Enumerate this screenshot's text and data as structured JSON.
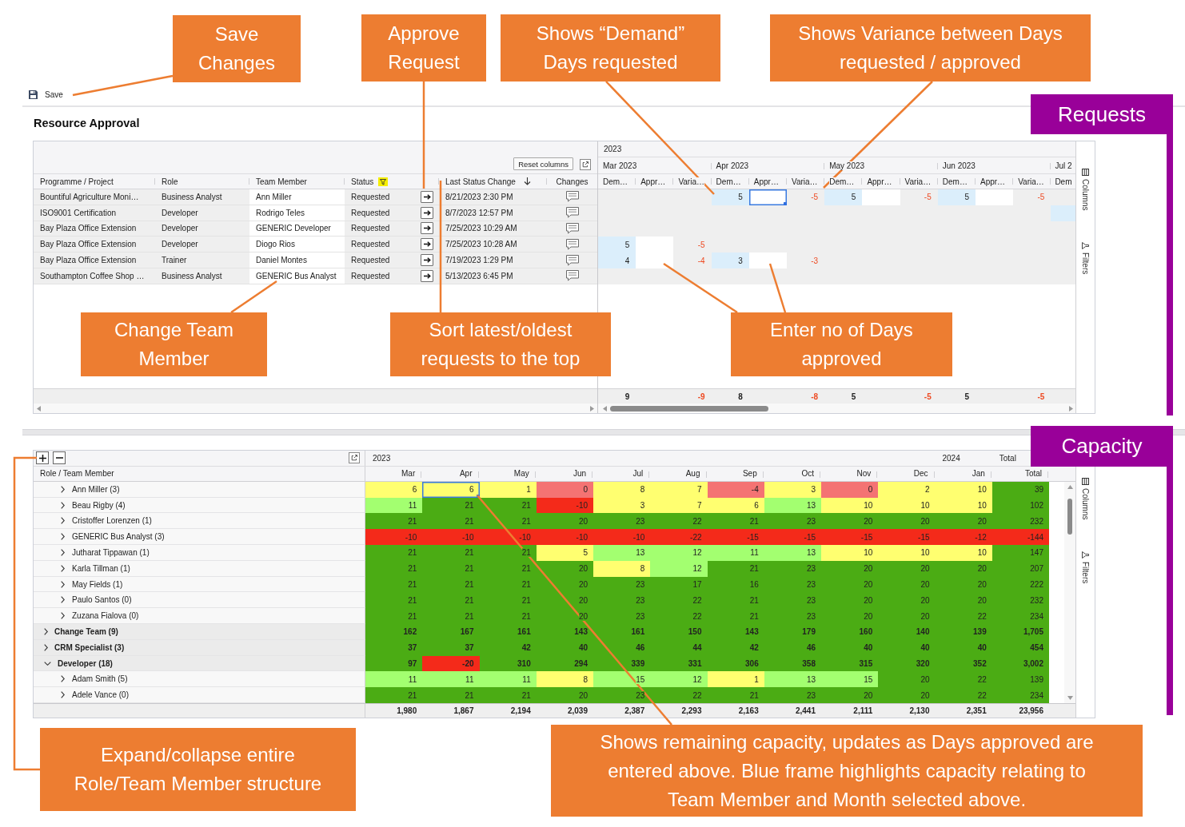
{
  "toolbar": {
    "save_label": "Save"
  },
  "page_title": "Resource Approval",
  "requests": {
    "reset_button": "Reset columns",
    "columns": [
      {
        "kind": "text",
        "label": "Programme / Project",
        "filtered": false,
        "sorted": false
      },
      {
        "kind": "text",
        "label": "Role",
        "filtered": false,
        "sorted": false
      },
      {
        "kind": "text",
        "label": "Team Member",
        "filtered": false,
        "sorted": false
      },
      {
        "kind": "text",
        "label": "Status",
        "filtered": true,
        "sorted": false
      },
      {
        "kind": "action"
      },
      {
        "kind": "text",
        "label": "Last Status Change",
        "filtered": false,
        "sorted": true
      },
      {
        "kind": "text",
        "label": "Changes",
        "filtered": false,
        "sorted": false
      }
    ],
    "year": "2023",
    "months": [
      {
        "label": "Mar 2023",
        "columns": [
          "Dem…",
          "Appr…",
          "Varia…"
        ]
      },
      {
        "label": "Apr 2023",
        "columns": [
          "Dem…",
          "Appr…",
          "Varia…"
        ]
      },
      {
        "label": "May 2023",
        "columns": [
          "Dem…",
          "Appr…",
          "Varia…"
        ]
      },
      {
        "label": "Jun 2023",
        "columns": [
          "Dem…",
          "Appr…",
          "Varia…"
        ]
      },
      {
        "label": "Jul 2",
        "columns": [
          "Dem"
        ]
      }
    ],
    "rows": [
      {
        "programme": "Bountiful Agriculture Moni…",
        "role": "Business Analyst",
        "team_member": "Ann Miller",
        "status": "Requested",
        "last_status_change": "8/21/2023 2:30 PM",
        "cells": [
          {
            "kind": "empty"
          },
          {
            "kind": "request",
            "demand": "5",
            "variance": "-5",
            "selected": true
          },
          {
            "kind": "request",
            "demand": "5",
            "variance": "-5",
            "selected": false
          },
          {
            "kind": "request",
            "demand": "5",
            "variance": "-5",
            "selected": false
          }
        ]
      },
      {
        "programme": "ISO9001 Certification",
        "role": "Developer",
        "team_member": "Rodrigo Teles",
        "status": "Requested",
        "last_status_change": "8/7/2023 12:57 PM",
        "cells": [
          {
            "kind": "empty"
          },
          {
            "kind": "empty"
          },
          {
            "kind": "empty"
          },
          {
            "kind": "empty"
          },
          {
            "kind": "request"
          }
        ]
      },
      {
        "programme": "Bay Plaza Office Extension",
        "role": "Developer",
        "team_member": "GENERIC Developer",
        "status": "Requested",
        "last_status_change": "7/25/2023 10:29 AM"
      },
      {
        "programme": "Bay Plaza Office Extension",
        "role": "Developer",
        "team_member": "Diogo Rios",
        "status": "Requested",
        "last_status_change": "7/25/2023 10:28 AM",
        "cells": [
          {
            "kind": "request",
            "demand": "5",
            "variance": "-5",
            "selected": false
          }
        ]
      },
      {
        "programme": "Bay Plaza Office Extension",
        "role": "Trainer",
        "team_member": "Daniel Montes",
        "status": "Requested",
        "last_status_change": "7/19/2023 1:29 PM",
        "cells": [
          {
            "kind": "request",
            "demand": "4",
            "variance": "-4",
            "selected": false
          },
          {
            "kind": "request",
            "demand": "3",
            "variance": "-3",
            "selected": false
          }
        ]
      },
      {
        "programme": "Southampton Coffee Shop …",
        "role": "Business Analyst",
        "team_member": "GENERIC Bus Analyst",
        "status": "Requested",
        "last_status_change": "5/13/2023 6:45 PM"
      }
    ],
    "totals": [
      {
        "demand": "9",
        "variance": "-9"
      },
      {
        "demand": "8",
        "variance": "-8"
      },
      {
        "demand": "5",
        "variance": "-5"
      },
      {
        "demand": "5",
        "variance": "-5"
      }
    ],
    "side_panel": [
      {
        "kind": "columns",
        "label": "Columns"
      },
      {
        "kind": "filters",
        "label": "Filters"
      }
    ]
  },
  "capacity": {
    "year_groups": [
      {
        "label": "2023",
        "months": [
          "Mar",
          "Apr",
          "May",
          "Jun",
          "Jul",
          "Aug",
          "Sep",
          "Oct",
          "Nov",
          "Dec"
        ]
      },
      {
        "label": "2024",
        "months": [
          "Jan"
        ]
      },
      {
        "label": "Total",
        "months": [
          "Total"
        ]
      }
    ],
    "row_header": "Role / Team Member",
    "rows": [
      {
        "kind": "role",
        "children": [
          {
            "kind": "member",
            "label": "Ann Miller (3)",
            "expanded": false,
            "values": [
              {
                "value": "6",
                "color": "#ffff70",
                "selected": false
              },
              {
                "value": "6",
                "color": "#ffff70",
                "selected": true
              },
              {
                "value": "1",
                "color": "#ffff70",
                "selected": false
              },
              {
                "value": "0",
                "color": "#f47373",
                "selected": false
              },
              {
                "value": "8",
                "color": "#ffff70",
                "selected": false
              },
              {
                "value": "7",
                "color": "#ffff70",
                "selected": false
              },
              {
                "value": "-4",
                "color": "#f47373",
                "selected": false
              },
              {
                "value": "3",
                "color": "#ffff70",
                "selected": false
              },
              {
                "value": "0",
                "color": "#f47373",
                "selected": false
              },
              {
                "value": "2",
                "color": "#ffff70",
                "selected": false
              },
              {
                "value": "10",
                "color": "#ffff70",
                "selected": false
              },
              {
                "value": "39",
                "color": "#4bac14",
                "selected": false
              }
            ]
          },
          {
            "kind": "member",
            "label": "Beau Rigby (4)",
            "expanded": false,
            "values": [
              {
                "value": "11",
                "color": "#a3ff70",
                "selected": false
              },
              {
                "value": "21",
                "color": "#4bac14",
                "selected": false
              },
              {
                "value": "21",
                "color": "#4bac14",
                "selected": false
              },
              {
                "value": "-10",
                "color": "#f42a1a",
                "selected": false
              },
              {
                "value": "3",
                "color": "#ffff70",
                "selected": false
              },
              {
                "value": "7",
                "color": "#ffff70",
                "selected": false
              },
              {
                "value": "6",
                "color": "#ffff70",
                "selected": false
              },
              {
                "value": "13",
                "color": "#a3ff70",
                "selected": false
              },
              {
                "value": "10",
                "color": "#ffff70",
                "selected": false
              },
              {
                "value": "10",
                "color": "#ffff70",
                "selected": false
              },
              {
                "value": "10",
                "color": "#ffff70",
                "selected": false
              },
              {
                "value": "102",
                "color": "#4bac14",
                "selected": false
              }
            ]
          },
          {
            "kind": "member",
            "label": "Cristoffer Lorenzen (1)",
            "expanded": false,
            "values": [
              {
                "value": "21",
                "color": "#4bac14",
                "selected": false
              },
              {
                "value": "21",
                "color": "#4bac14",
                "selected": false
              },
              {
                "value": "21",
                "color": "#4bac14",
                "selected": false
              },
              {
                "value": "20",
                "color": "#4bac14",
                "selected": false
              },
              {
                "value": "23",
                "color": "#4bac14",
                "selected": false
              },
              {
                "value": "22",
                "color": "#4bac14",
                "selected": false
              },
              {
                "value": "21",
                "color": "#4bac14",
                "selected": false
              },
              {
                "value": "23",
                "color": "#4bac14",
                "selected": false
              },
              {
                "value": "20",
                "color": "#4bac14",
                "selected": false
              },
              {
                "value": "20",
                "color": "#4bac14",
                "selected": false
              },
              {
                "value": "20",
                "color": "#4bac14",
                "selected": false
              },
              {
                "value": "232",
                "color": "#4bac14",
                "selected": false
              }
            ]
          },
          {
            "kind": "member",
            "label": "GENERIC Bus Analyst (3)",
            "expanded": false,
            "values": [
              {
                "value": "-10",
                "color": "#f42a1a",
                "selected": false
              },
              {
                "value": "-10",
                "color": "#f42a1a",
                "selected": false
              },
              {
                "value": "-10",
                "color": "#f42a1a",
                "selected": false
              },
              {
                "value": "-10",
                "color": "#f42a1a",
                "selected": false
              },
              {
                "value": "-10",
                "color": "#f42a1a",
                "selected": false
              },
              {
                "value": "-22",
                "color": "#f42a1a",
                "selected": false
              },
              {
                "value": "-15",
                "color": "#f42a1a",
                "selected": false
              },
              {
                "value": "-15",
                "color": "#f42a1a",
                "selected": false
              },
              {
                "value": "-15",
                "color": "#f42a1a",
                "selected": false
              },
              {
                "value": "-15",
                "color": "#f42a1a",
                "selected": false
              },
              {
                "value": "-12",
                "color": "#f42a1a",
                "selected": false
              },
              {
                "value": "-144",
                "color": "#f42a1a",
                "selected": false
              }
            ]
          },
          {
            "kind": "member",
            "label": "Jutharat Tippawan (1)",
            "expanded": false,
            "values": [
              {
                "value": "21",
                "color": "#4bac14",
                "selected": false
              },
              {
                "value": "21",
                "color": "#4bac14",
                "selected": false
              },
              {
                "value": "21",
                "color": "#4bac14",
                "selected": false
              },
              {
                "value": "5",
                "color": "#ffff70",
                "selected": false
              },
              {
                "value": "13",
                "color": "#a3ff70",
                "selected": false
              },
              {
                "value": "12",
                "color": "#a3ff70",
                "selected": false
              },
              {
                "value": "11",
                "color": "#a3ff70",
                "selected": false
              },
              {
                "value": "13",
                "color": "#a3ff70",
                "selected": false
              },
              {
                "value": "10",
                "color": "#ffff70",
                "selected": false
              },
              {
                "value": "10",
                "color": "#ffff70",
                "selected": false
              },
              {
                "value": "10",
                "color": "#ffff70",
                "selected": false
              },
              {
                "value": "147",
                "color": "#4bac14",
                "selected": false
              }
            ]
          },
          {
            "kind": "member",
            "label": "Karla Tillman (1)",
            "expanded": false,
            "values": [
              {
                "value": "21",
                "color": "#4bac14",
                "selected": false
              },
              {
                "value": "21",
                "color": "#4bac14",
                "selected": false
              },
              {
                "value": "21",
                "color": "#4bac14",
                "selected": false
              },
              {
                "value": "20",
                "color": "#4bac14",
                "selected": false
              },
              {
                "value": "8",
                "color": "#ffff70",
                "selected": false
              },
              {
                "value": "12",
                "color": "#a3ff70",
                "selected": false
              },
              {
                "value": "21",
                "color": "#4bac14",
                "selected": false
              },
              {
                "value": "23",
                "color": "#4bac14",
                "selected": false
              },
              {
                "value": "20",
                "color": "#4bac14",
                "selected": false
              },
              {
                "value": "20",
                "color": "#4bac14",
                "selected": false
              },
              {
                "value": "20",
                "color": "#4bac14",
                "selected": false
              },
              {
                "value": "207",
                "color": "#4bac14",
                "selected": false
              }
            ]
          },
          {
            "kind": "member",
            "label": "May Fields (1)",
            "expanded": false,
            "values": [
              {
                "value": "21",
                "color": "#4bac14",
                "selected": false
              },
              {
                "value": "21",
                "color": "#4bac14",
                "selected": false
              },
              {
                "value": "21",
                "color": "#4bac14",
                "selected": false
              },
              {
                "value": "20",
                "color": "#4bac14",
                "selected": false
              },
              {
                "value": "23",
                "color": "#4bac14",
                "selected": false
              },
              {
                "value": "17",
                "color": "#4bac14",
                "selected": false
              },
              {
                "value": "16",
                "color": "#4bac14",
                "selected": false
              },
              {
                "value": "23",
                "color": "#4bac14",
                "selected": false
              },
              {
                "value": "20",
                "color": "#4bac14",
                "selected": false
              },
              {
                "value": "20",
                "color": "#4bac14",
                "selected": false
              },
              {
                "value": "20",
                "color": "#4bac14",
                "selected": false
              },
              {
                "value": "222",
                "color": "#4bac14",
                "selected": false
              }
            ]
          },
          {
            "kind": "member",
            "label": "Paulo Santos (0)",
            "expanded": false,
            "values": [
              {
                "value": "21",
                "color": "#4bac14",
                "selected": false
              },
              {
                "value": "21",
                "color": "#4bac14",
                "selected": false
              },
              {
                "value": "21",
                "color": "#4bac14",
                "selected": false
              },
              {
                "value": "20",
                "color": "#4bac14",
                "selected": false
              },
              {
                "value": "23",
                "color": "#4bac14",
                "selected": false
              },
              {
                "value": "22",
                "color": "#4bac14",
                "selected": false
              },
              {
                "value": "21",
                "color": "#4bac14",
                "selected": false
              },
              {
                "value": "23",
                "color": "#4bac14",
                "selected": false
              },
              {
                "value": "20",
                "color": "#4bac14",
                "selected": false
              },
              {
                "value": "20",
                "color": "#4bac14",
                "selected": false
              },
              {
                "value": "20",
                "color": "#4bac14",
                "selected": false
              },
              {
                "value": "232",
                "color": "#4bac14",
                "selected": false
              }
            ]
          },
          {
            "kind": "member",
            "label": "Zuzana Fialova (0)",
            "expanded": false,
            "values": [
              {
                "value": "21",
                "color": "#4bac14",
                "selected": false
              },
              {
                "value": "21",
                "color": "#4bac14",
                "selected": false
              },
              {
                "value": "21",
                "color": "#4bac14",
                "selected": false
              },
              {
                "value": "20",
                "color": "#4bac14",
                "selected": false
              },
              {
                "value": "23",
                "color": "#4bac14",
                "selected": false
              },
              {
                "value": "22",
                "color": "#4bac14",
                "selected": false
              },
              {
                "value": "21",
                "color": "#4bac14",
                "selected": false
              },
              {
                "value": "23",
                "color": "#4bac14",
                "selected": false
              },
              {
                "value": "20",
                "color": "#4bac14",
                "selected": false
              },
              {
                "value": "20",
                "color": "#4bac14",
                "selected": false
              },
              {
                "value": "22",
                "color": "#4bac14",
                "selected": false
              },
              {
                "value": "234",
                "color": "#4bac14",
                "selected": false
              }
            ]
          }
        ]
      },
      {
        "kind": "role",
        "label": "Change Team (9)",
        "expanded": false,
        "values": [
          {
            "value": "162",
            "color": "#4bac14",
            "selected": false
          },
          {
            "value": "167",
            "color": "#4bac14",
            "selected": false
          },
          {
            "value": "161",
            "color": "#4bac14",
            "selected": false
          },
          {
            "value": "143",
            "color": "#4bac14",
            "selected": false
          },
          {
            "value": "161",
            "color": "#4bac14",
            "selected": false
          },
          {
            "value": "150",
            "color": "#4bac14",
            "selected": false
          },
          {
            "value": "143",
            "color": "#4bac14",
            "selected": false
          },
          {
            "value": "179",
            "color": "#4bac14",
            "selected": false
          },
          {
            "value": "160",
            "color": "#4bac14",
            "selected": false
          },
          {
            "value": "140",
            "color": "#4bac14",
            "selected": false
          },
          {
            "value": "139",
            "color": "#4bac14",
            "selected": false
          },
          {
            "value": "1,705",
            "color": "#4bac14",
            "selected": false
          }
        ]
      },
      {
        "kind": "role",
        "label": "CRM Specialist (3)",
        "expanded": false,
        "values": [
          {
            "value": "37",
            "color": "#4bac14",
            "selected": false
          },
          {
            "value": "37",
            "color": "#4bac14",
            "selected": false
          },
          {
            "value": "42",
            "color": "#4bac14",
            "selected": false
          },
          {
            "value": "40",
            "color": "#4bac14",
            "selected": false
          },
          {
            "value": "46",
            "color": "#4bac14",
            "selected": false
          },
          {
            "value": "44",
            "color": "#4bac14",
            "selected": false
          },
          {
            "value": "42",
            "color": "#4bac14",
            "selected": false
          },
          {
            "value": "46",
            "color": "#4bac14",
            "selected": false
          },
          {
            "value": "40",
            "color": "#4bac14",
            "selected": false
          },
          {
            "value": "40",
            "color": "#4bac14",
            "selected": false
          },
          {
            "value": "40",
            "color": "#4bac14",
            "selected": false
          },
          {
            "value": "454",
            "color": "#4bac14",
            "selected": false
          }
        ]
      },
      {
        "kind": "role",
        "label": "Developer (18)",
        "expanded": true,
        "values": [
          {
            "value": "97",
            "color": "#4bac14",
            "selected": false
          },
          {
            "value": "-20",
            "color": "#f42a1a",
            "selected": false
          },
          {
            "value": "310",
            "color": "#4bac14",
            "selected": false
          },
          {
            "value": "294",
            "color": "#4bac14",
            "selected": false
          },
          {
            "value": "339",
            "color": "#4bac14",
            "selected": false
          },
          {
            "value": "331",
            "color": "#4bac14",
            "selected": false
          },
          {
            "value": "306",
            "color": "#4bac14",
            "selected": false
          },
          {
            "value": "358",
            "color": "#4bac14",
            "selected": false
          },
          {
            "value": "315",
            "color": "#4bac14",
            "selected": false
          },
          {
            "value": "320",
            "color": "#4bac14",
            "selected": false
          },
          {
            "value": "352",
            "color": "#4bac14",
            "selected": false
          },
          {
            "value": "3,002",
            "color": "#4bac14",
            "selected": false
          }
        ],
        "children": [
          {
            "kind": "member",
            "label": "Adam Smith (5)",
            "expanded": false,
            "values": [
              {
                "value": "11",
                "color": "#a3ff70",
                "selected": false
              },
              {
                "value": "11",
                "color": "#a3ff70",
                "selected": false
              },
              {
                "value": "11",
                "color": "#a3ff70",
                "selected": false
              },
              {
                "value": "8",
                "color": "#ffff70",
                "selected": false
              },
              {
                "value": "15",
                "color": "#a3ff70",
                "selected": false
              },
              {
                "value": "12",
                "color": "#a3ff70",
                "selected": false
              },
              {
                "value": "1",
                "color": "#ffff70",
                "selected": false
              },
              {
                "value": "13",
                "color": "#a3ff70",
                "selected": false
              },
              {
                "value": "15",
                "color": "#a3ff70",
                "selected": false
              },
              {
                "value": "20",
                "color": "#4bac14",
                "selected": false
              },
              {
                "value": "22",
                "color": "#4bac14",
                "selected": false
              },
              {
                "value": "139",
                "color": "#4bac14",
                "selected": false
              }
            ]
          },
          {
            "kind": "member",
            "label": "Adele Vance (0)",
            "expanded": false,
            "values": [
              {
                "value": "21",
                "color": "#4bac14",
                "selected": false
              },
              {
                "value": "21",
                "color": "#4bac14",
                "selected": false
              },
              {
                "value": "21",
                "color": "#4bac14",
                "selected": false
              },
              {
                "value": "20",
                "color": "#4bac14",
                "selected": false
              },
              {
                "value": "23",
                "color": "#4bac14",
                "selected": false
              },
              {
                "value": "22",
                "color": "#4bac14",
                "selected": false
              },
              {
                "value": "21",
                "color": "#4bac14",
                "selected": false
              },
              {
                "value": "23",
                "color": "#4bac14",
                "selected": false
              },
              {
                "value": "20",
                "color": "#4bac14",
                "selected": false
              },
              {
                "value": "20",
                "color": "#4bac14",
                "selected": false
              },
              {
                "value": "22",
                "color": "#4bac14",
                "selected": false
              },
              {
                "value": "234",
                "color": "#4bac14",
                "selected": false
              }
            ]
          }
        ]
      }
    ],
    "totals": [
      "1,980",
      "1,867",
      "2,194",
      "2,039",
      "2,387",
      "2,293",
      "2,163",
      "2,441",
      "2,111",
      "2,130",
      "2,351",
      "23,956"
    ],
    "side_panel": [
      {
        "kind": "columns",
        "label": "Columns"
      },
      {
        "kind": "filters",
        "label": "Filters"
      }
    ]
  },
  "annotations": [
    {
      "kind": "callout",
      "text": "Save Changes"
    },
    {
      "kind": "callout",
      "text": "Approve Request"
    },
    {
      "kind": "callout",
      "text": "Shows “Demand” Days requested"
    },
    {
      "kind": "callout",
      "text": "Shows Variance between Days requested / approved"
    },
    {
      "kind": "section",
      "text": "Requests"
    },
    {
      "kind": "callout",
      "text": "Change Team Member"
    },
    {
      "kind": "callout",
      "text": "Sort latest/oldest requests to the top"
    },
    {
      "kind": "callout",
      "text": "Enter no of Days approved"
    },
    {
      "kind": "section",
      "text": "Capacity"
    },
    {
      "kind": "callout",
      "text": "Expand/collapse entire Role/Team Member structure"
    },
    {
      "kind": "callout",
      "text": "Shows remaining capacity, updates as Days approved are entered above. Blue frame highlights capacity relating to Team Member and Month selected above."
    }
  ]
}
